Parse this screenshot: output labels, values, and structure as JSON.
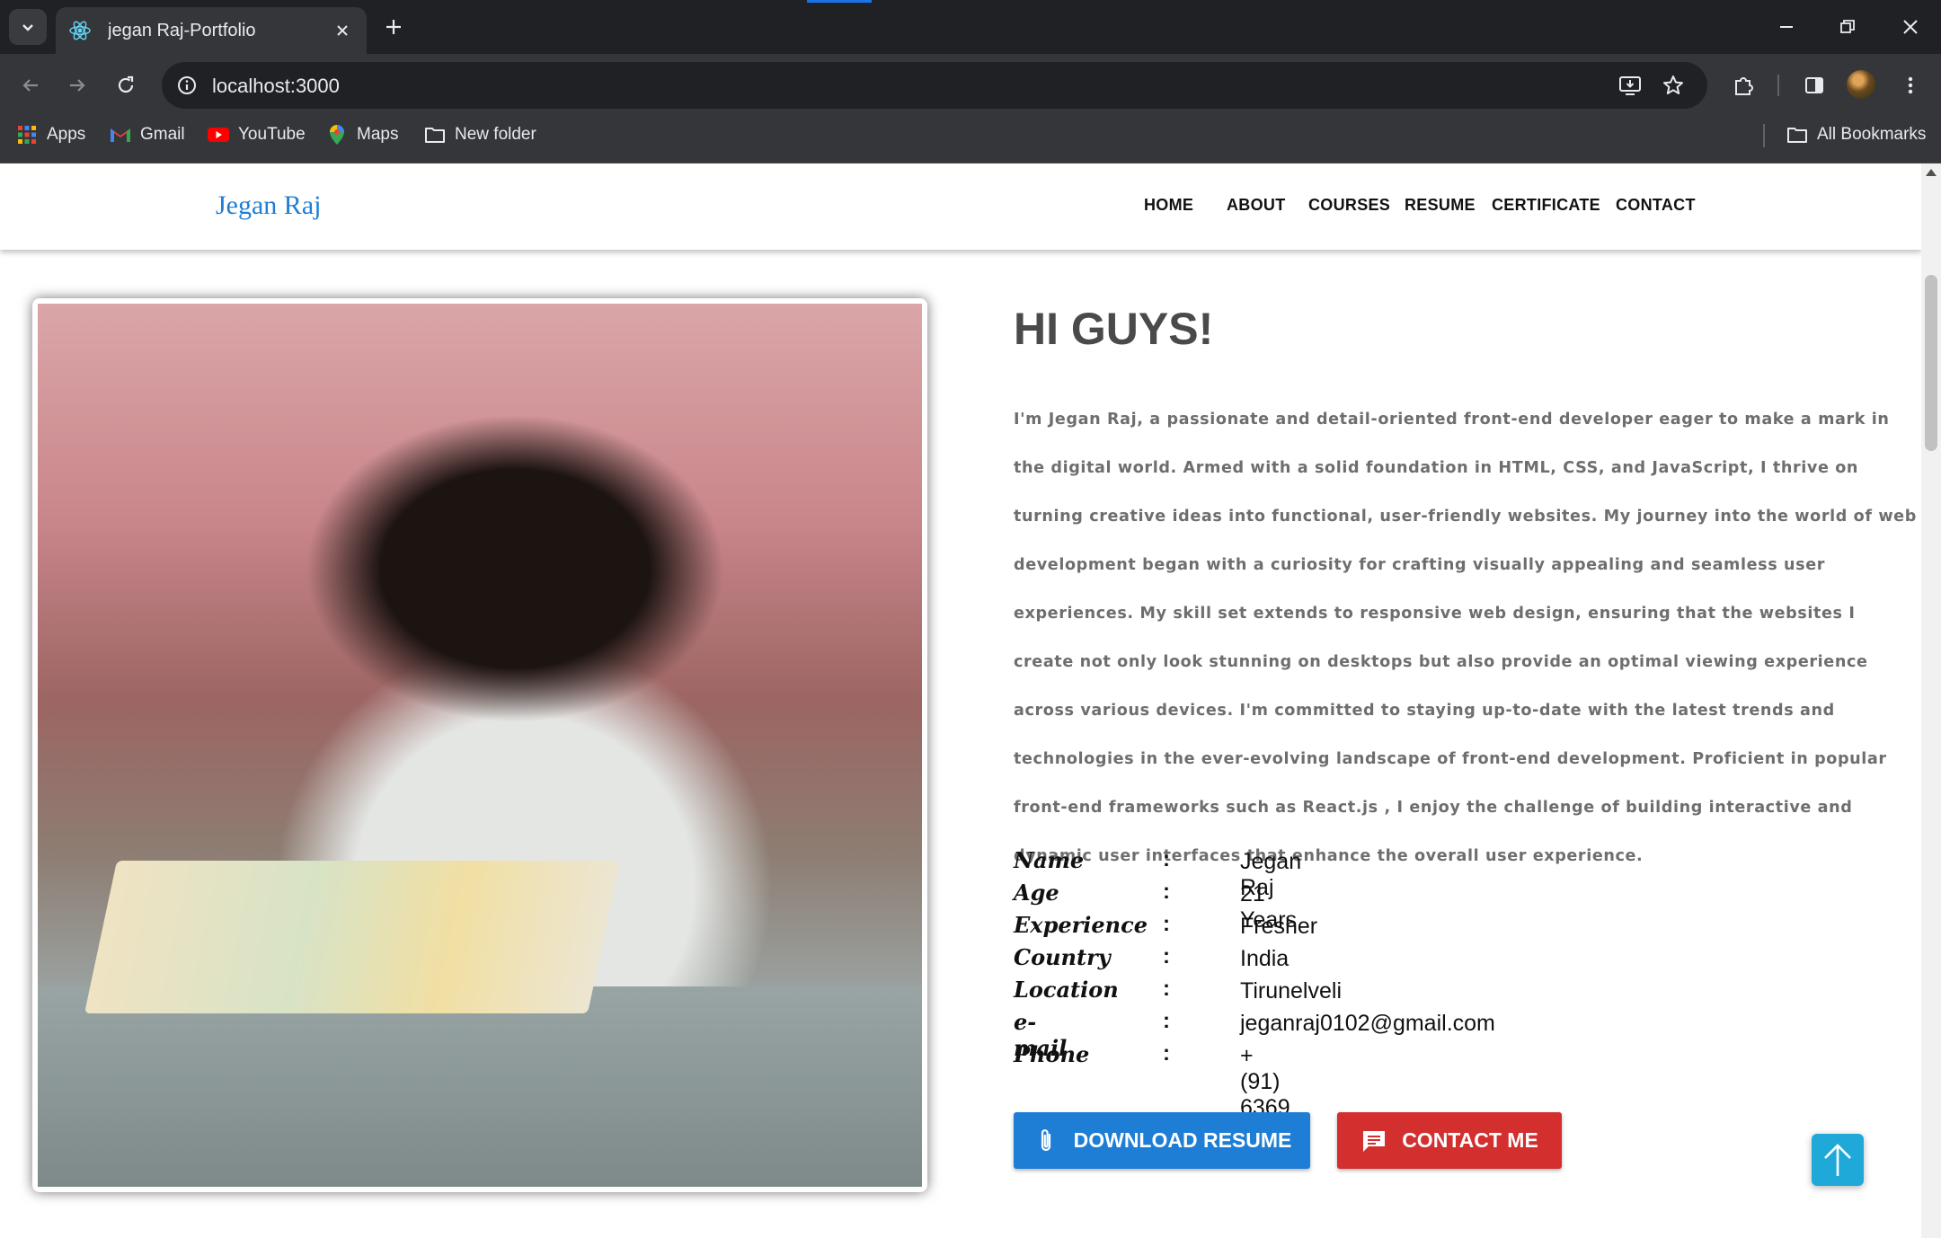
{
  "browser": {
    "tab_title": "jegan Raj-Portfolio",
    "url": "localhost:3000",
    "bookmarks": [
      {
        "label": "Apps",
        "icon": "apps-grid-icon"
      },
      {
        "label": "Gmail",
        "icon": "gmail-icon"
      },
      {
        "label": "YouTube",
        "icon": "youtube-icon"
      },
      {
        "label": "Maps",
        "icon": "maps-pin-icon"
      },
      {
        "label": "New folder",
        "icon": "folder-icon"
      }
    ],
    "all_bookmarks": "All Bookmarks"
  },
  "site": {
    "brand": "Jegan Raj",
    "nav": [
      "HOME",
      "ABOUT",
      "COURSES",
      "RESUME",
      "CERTIFICATE",
      "CONTACT"
    ]
  },
  "hero": {
    "title": "HI GUYS!",
    "bio": "I'm Jegan Raj, a passionate and detail-oriented front-end developer eager to make a mark in the digital world. Armed with a solid foundation in HTML, CSS, and JavaScript, I thrive on turning creative ideas into functional, user-friendly websites. My journey into the world of web development began with a curiosity for crafting visually appealing and seamless user experiences. My skill set extends to responsive web design, ensuring that the websites I create not only look stunning on desktops but also provide an optimal viewing experience across various devices. I'm committed to staying up-to-date with the latest trends and technologies in the ever-evolving landscape of front-end development. Proficient in popular front-end frameworks such as React.js , I enjoy the challenge of building interactive and dynamic user interfaces that enhance the overall user experience.",
    "info": [
      {
        "label": "Name",
        "value": "Jegan Raj"
      },
      {
        "label": "Age",
        "value": "21 Years"
      },
      {
        "label": "Experience",
        "value": "Fresher"
      },
      {
        "label": "Country",
        "value": "India"
      },
      {
        "label": "Location",
        "value": "Tirunelveli"
      },
      {
        "label": "e-mail",
        "value": "jeganraj0102@gmail.com"
      },
      {
        "label": "Phone",
        "value": "+ (91) 6369 121 662"
      }
    ],
    "colon": ":",
    "download_label": "DOWNLOAD RESUME",
    "contact_label": "CONTACT ME"
  },
  "colors": {
    "brand_blue": "#1e7ed6",
    "contact_red": "#d32f2f",
    "scroll_top": "#1fa9d9"
  }
}
